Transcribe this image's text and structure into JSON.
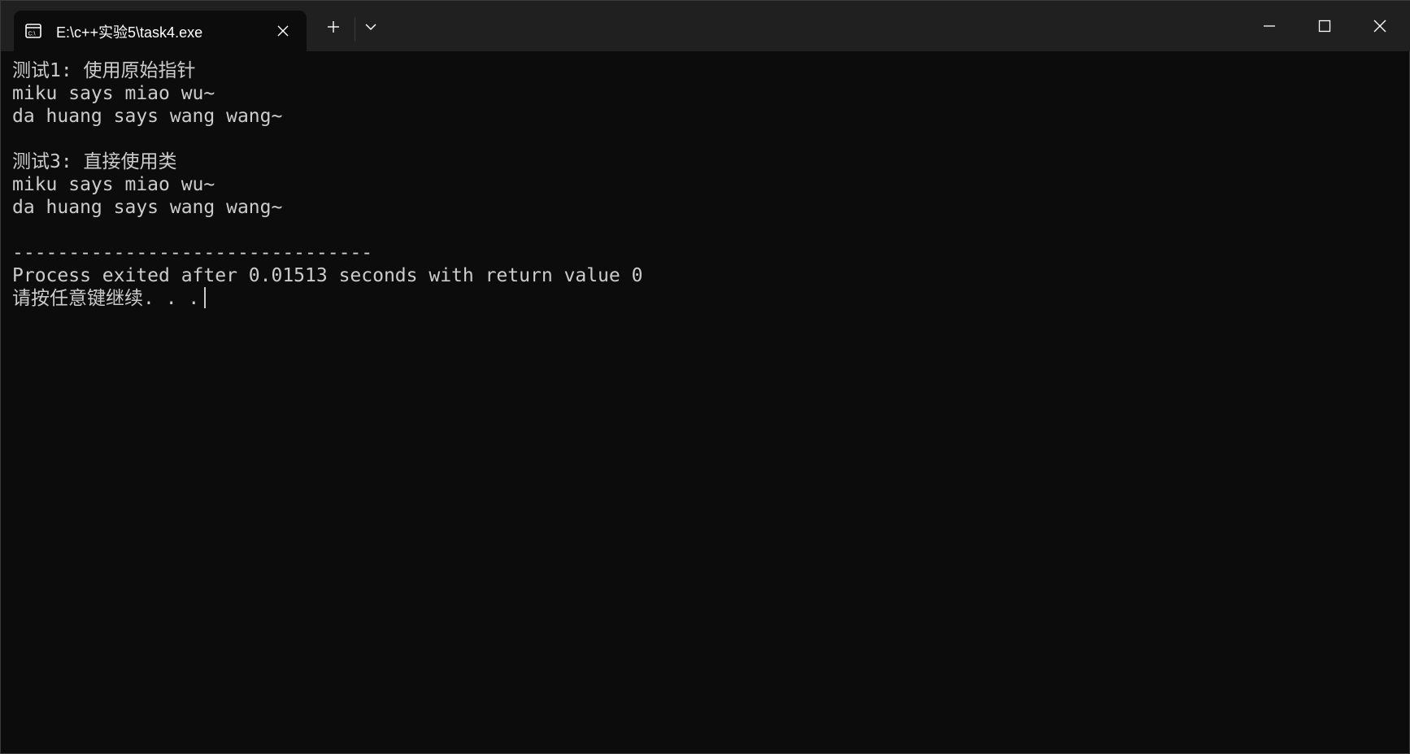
{
  "window": {
    "tab_title": "E:\\c++实验5\\task4.exe",
    "tab_icon": "console-app-icon",
    "new_tab_icon": "plus-icon",
    "dropdown_icon": "chevron-down-icon",
    "minimize_icon": "minimize-icon",
    "maximize_icon": "maximize-icon",
    "close_icon": "close-icon"
  },
  "console": {
    "lines": [
      "测试1: 使用原始指针",
      "miku says miao wu~",
      "da huang says wang wang~",
      "",
      "测试3: 直接使用类",
      "miku says miao wu~",
      "da huang says wang wang~",
      "",
      "--------------------------------",
      "Process exited after 0.01513 seconds with return value 0",
      "请按任意键继续. . ."
    ]
  },
  "colors": {
    "console_background": "#0c0c0c",
    "titlebar_background": "#202020",
    "text": "#cccccc"
  }
}
